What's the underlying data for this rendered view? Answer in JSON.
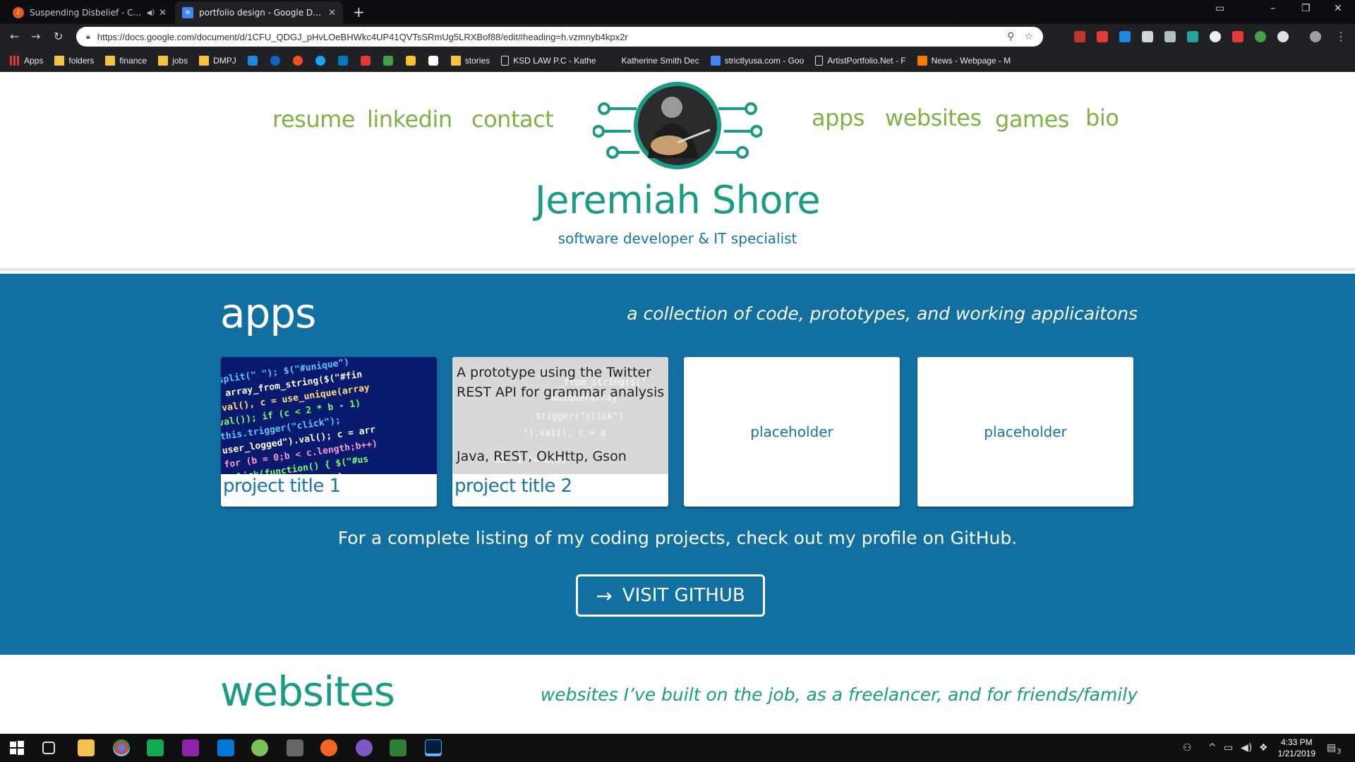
{
  "browser": {
    "tabs": [
      {
        "label": "Suspending Disbelief - Circa",
        "active": false,
        "has_audio": true
      },
      {
        "label": "portfolio design - Google Docs",
        "active": true,
        "has_audio": false
      }
    ],
    "new_tab_glyph": "+",
    "url": "https://docs.google.com/document/d/1CFU_QDGJ_pHvLOeBHWkc4UP41QVTsSRmUg5LRXBof88/edit#heading=h.vzmnyb4kpx2r",
    "window_controls": {
      "minimize": "–",
      "maximize": "❐",
      "close": "✕"
    },
    "bookmarks": [
      {
        "label": "Apps",
        "icon": "apps-grid-icon"
      },
      {
        "label": "folders",
        "icon": "folder-icon"
      },
      {
        "label": "finance",
        "icon": "folder-icon"
      },
      {
        "label": "jobs",
        "icon": "folder-icon"
      },
      {
        "label": "DMPJ",
        "icon": "folder-icon"
      },
      {
        "label": "stories",
        "icon": "folder-icon"
      },
      {
        "label": "KSD LAW P.C - Kathe",
        "icon": "document-icon"
      },
      {
        "label": "Katherine Smith Dec",
        "icon": "blank-icon"
      },
      {
        "label": "strictlyusa.com - Goo",
        "icon": "docs-icon"
      },
      {
        "label": "ArtistPortfolio.Net - F",
        "icon": "document-icon"
      },
      {
        "label": "News - Webpage - M",
        "icon": "news-icon"
      }
    ]
  },
  "site": {
    "nav_left": [
      "resume",
      "linkedin",
      "contact"
    ],
    "nav_right": [
      "apps",
      "websites",
      "games",
      "bio"
    ],
    "name": "Jeremiah Shore",
    "tagline": "software developer & IT specialist",
    "colors": {
      "green": "#7cb342",
      "teal": "#1a9b84",
      "blue": "#1576a6",
      "section_bg": "#1170a0"
    }
  },
  "apps_section": {
    "title": "apps",
    "subtitle": "a collection of code, prototypes, and working applicaitons",
    "cards": [
      {
        "title": "project title 1"
      },
      {
        "title": "project title 2",
        "description": "A prototype using the Twitter REST API for grammar analysis",
        "tech": "Java, REST, OkHttp, Gson"
      },
      {
        "placeholder": "placeholder"
      },
      {
        "placeholder": "placeholder"
      }
    ],
    "cta_text": "For a complete listing of my coding projects, check out my profile on GitHub.",
    "button_label": "VISIT GITHUB"
  },
  "websites_section": {
    "title": "websites",
    "subtitle": "websites I’ve built on the job, as a freelancer, and for friends/family"
  },
  "taskbar": {
    "time": "4:33 PM",
    "date": "1/21/2019",
    "notification_count": "3"
  }
}
